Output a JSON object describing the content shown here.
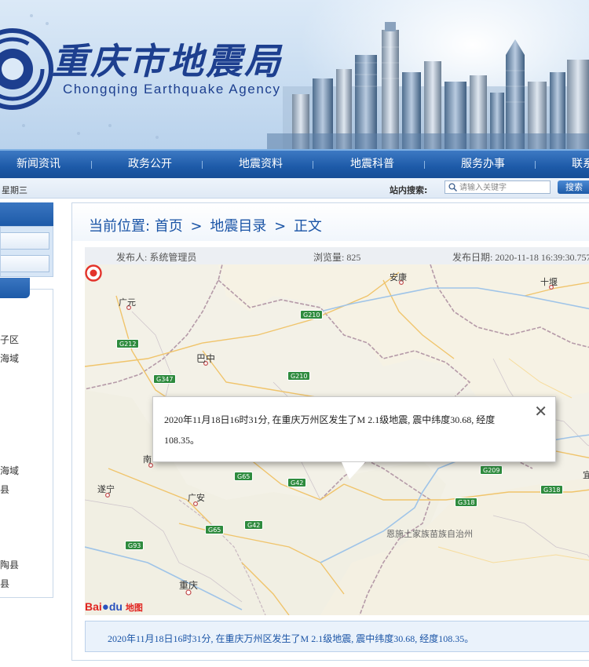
{
  "header": {
    "title_cn": "重庆市地震局",
    "title_en": "Chongqing Earthquake Agency"
  },
  "nav": {
    "items": [
      "新闻资讯",
      "政务公开",
      "地震资料",
      "地震科普",
      "服务办事",
      "联系"
    ]
  },
  "infobar": {
    "weekday": "星期三",
    "search_label": "站内搜索:",
    "search_placeholder": "请输入关键字",
    "search_button": "搜索"
  },
  "sidebar": {
    "items": [
      "子区",
      "海域",
      "海域",
      "县",
      "陶县",
      "县"
    ]
  },
  "breadcrumb": {
    "prefix": "当前位置:",
    "items": [
      "首页",
      "地震目录",
      "正文"
    ],
    "separator": ">"
  },
  "meta": {
    "author": "发布人: 系统管理员",
    "views": "浏览量: 825",
    "date": "发布日期: 2020-11-18 16:39:30.757"
  },
  "map": {
    "places": [
      "安康",
      "十堰",
      "广元",
      "巴中",
      "南",
      "遂宁",
      "广安",
      "重庆",
      "恩施土家族苗族自治州",
      "宜"
    ],
    "highways": [
      "G210",
      "G212",
      "G347",
      "G210",
      "G65",
      "G42",
      "G65",
      "G42",
      "G93",
      "G209",
      "G318",
      "G318"
    ],
    "popup_text": "2020年11月18日16时31分, 在重庆万州区发生了M 2.1级地震, 震中纬度30.68, 经度108.35。",
    "popup_close": "✕",
    "logo_text": "Bai",
    "logo_text2": "du",
    "logo_map": "地图"
  },
  "caption": "2020年11月18日16时31分, 在重庆万州区发生了M 2.1级地震, 震中纬度30.68, 经度108.35。",
  "colors": {
    "brand_blue": "#1d5aa8",
    "link_blue": "#1a54a6",
    "marker_red": "#e3332b",
    "highway_green": "#2e8b3e"
  }
}
